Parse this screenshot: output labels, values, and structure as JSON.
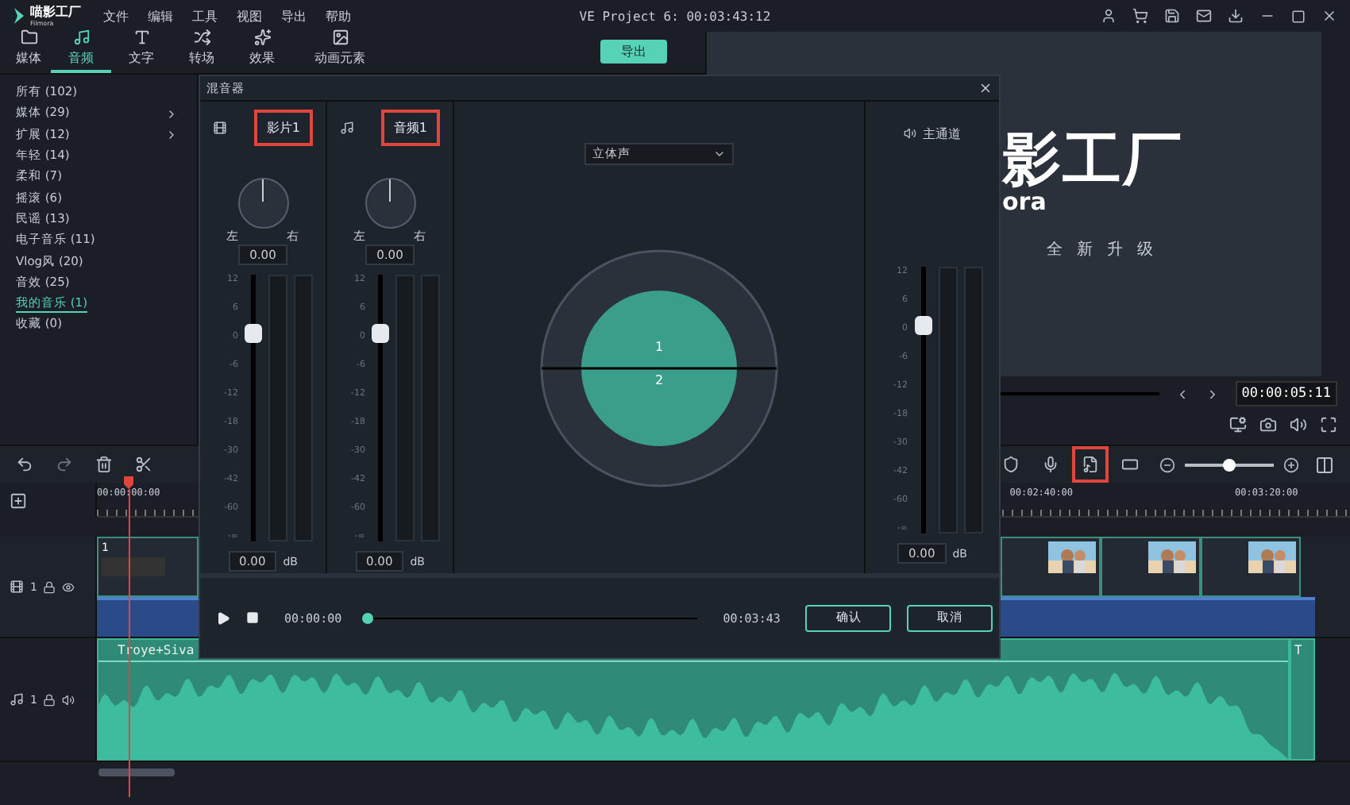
{
  "app": {
    "logo": "喵影工厂",
    "logo_sub": "Filmora"
  },
  "menu": [
    "文件",
    "编辑",
    "工具",
    "视图",
    "导出",
    "帮助"
  ],
  "title": "VE Project 6: 00:03:43:12",
  "tabs": [
    {
      "label": "媒体",
      "kind": "folder",
      "selected": false
    },
    {
      "label": "音频",
      "kind": "music",
      "selected": true
    },
    {
      "label": "文字",
      "kind": "text",
      "selected": false
    },
    {
      "label": "转场",
      "kind": "transition",
      "selected": false
    },
    {
      "label": "效果",
      "kind": "effect",
      "selected": false
    },
    {
      "label": "动画元素",
      "kind": "element",
      "selected": false
    }
  ],
  "export_button": "导出",
  "categories": [
    {
      "label": "所有 (102)",
      "expandable": false,
      "selected": false
    },
    {
      "label": "媒体 (29)",
      "expandable": true,
      "selected": false
    },
    {
      "label": "扩展 (12)",
      "expandable": true,
      "selected": false
    },
    {
      "label": "年轻 (14)",
      "expandable": false,
      "selected": false
    },
    {
      "label": "柔和 (7)",
      "expandable": false,
      "selected": false
    },
    {
      "label": "摇滚 (6)",
      "expandable": false,
      "selected": false
    },
    {
      "label": "民谣 (13)",
      "expandable": false,
      "selected": false
    },
    {
      "label": "电子音乐 (11)",
      "expandable": false,
      "selected": false
    },
    {
      "label": "Vlog风 (20)",
      "expandable": false,
      "selected": false
    },
    {
      "label": "音效 (25)",
      "expandable": false,
      "selected": false
    },
    {
      "label": "我的音乐 (1)",
      "expandable": false,
      "selected": true
    },
    {
      "label": "收藏 (0)",
      "expandable": false,
      "selected": false
    }
  ],
  "preview": {
    "brand": "影工厂",
    "brand_sub": "ora",
    "slogan": "全新升级",
    "timecode": "00:00:05:11"
  },
  "timeline_tools": [
    {
      "kind": "marker",
      "highlighted": false
    },
    {
      "kind": "mic",
      "highlighted": false
    },
    {
      "kind": "mixer",
      "highlighted": true
    },
    {
      "kind": "fit",
      "highlighted": false
    }
  ],
  "zoom": {
    "level": 0.5
  },
  "ruler": [
    "00:00:00:00",
    "00:02:40:00",
    "00:03:20:00"
  ],
  "tracks": [
    {
      "kind": "video",
      "number": "1",
      "clip_label": "1"
    },
    {
      "kind": "audio",
      "number": "1",
      "clip_label": "Troye+Siva",
      "end_clip_label": "T"
    }
  ],
  "mixer": {
    "title": "混音器",
    "channels": [
      {
        "kind": "video",
        "name": "影片1",
        "highlighted": true,
        "scale": [
          "12",
          "6",
          "0",
          "-6",
          "-12",
          "-18",
          "-30",
          "-42",
          "-60",
          "-∞"
        ],
        "left": "左",
        "right": "右",
        "pan": "0.00",
        "level": 0.78,
        "volume": "0.00",
        "unit": "dB"
      },
      {
        "kind": "audio",
        "name": "音频1",
        "highlighted": true,
        "scale": [
          "12",
          "6",
          "0",
          "-6",
          "-12",
          "-18",
          "-30",
          "-42",
          "-60",
          "-∞"
        ],
        "left": "左",
        "right": "右",
        "pan": "0.00",
        "level": 0.78,
        "volume": "0.00",
        "unit": "dB"
      }
    ],
    "mode": "立体声",
    "panner": [
      "1",
      "2"
    ],
    "master": {
      "name": "主通道",
      "scale": [
        "12",
        "6",
        "0",
        "-6",
        "-12",
        "-18",
        "-30",
        "-42",
        "-60",
        "-∞"
      ],
      "level": 0.78,
      "volume": "0.00",
      "unit": "dB"
    },
    "current": "00:00:00",
    "progress": {
      "level": 0
    },
    "total": "00:03:43",
    "buttons": [
      "确认",
      "取消"
    ]
  }
}
